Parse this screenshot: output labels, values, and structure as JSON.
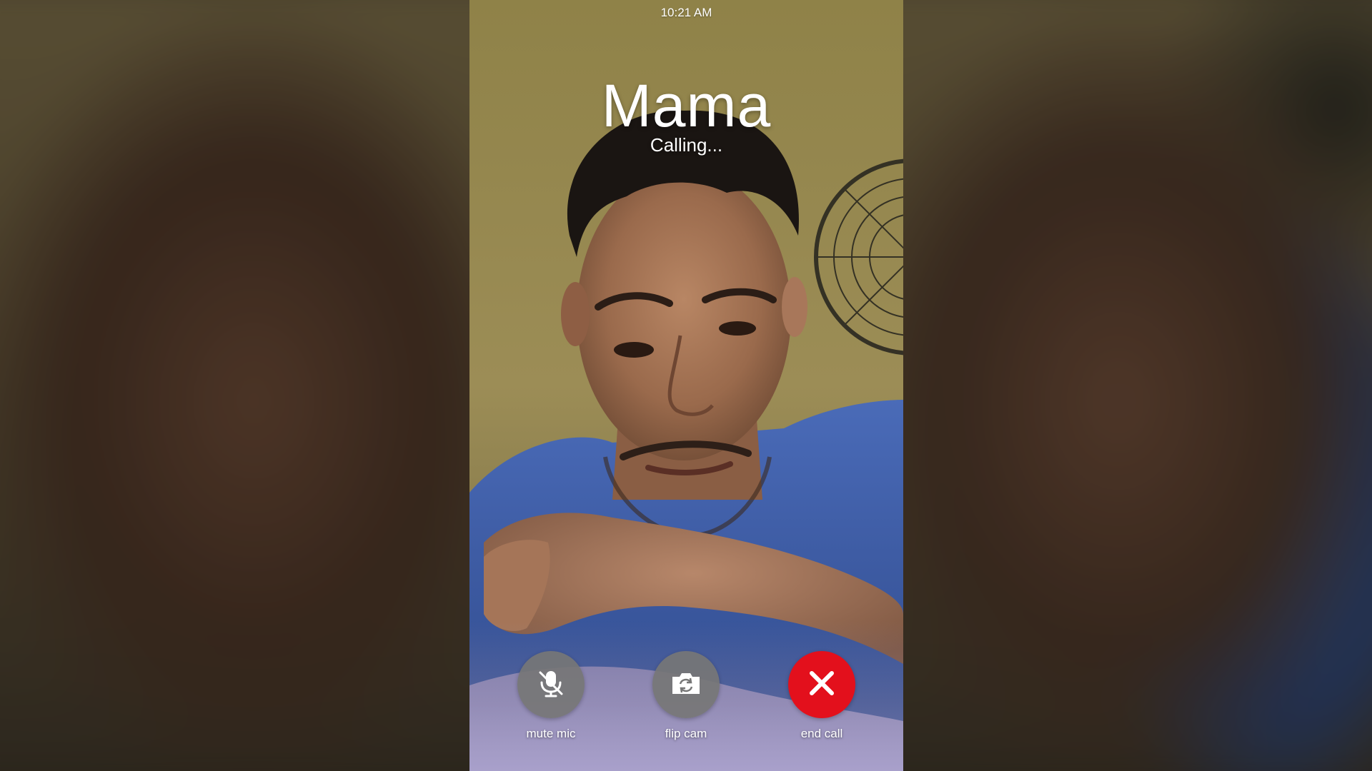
{
  "status_bar": {
    "time": "10:21 AM"
  },
  "call": {
    "contact_name": "Mama",
    "status": "Calling..."
  },
  "controls": {
    "mute": {
      "label": "mute mic",
      "icon": "mic-off-icon"
    },
    "flip": {
      "label": "flip cam",
      "icon": "camera-flip-icon"
    },
    "end": {
      "label": "end call",
      "icon": "close-icon",
      "color": "#e3101c"
    }
  },
  "video": {
    "description_icon": "self-camera-preview"
  }
}
